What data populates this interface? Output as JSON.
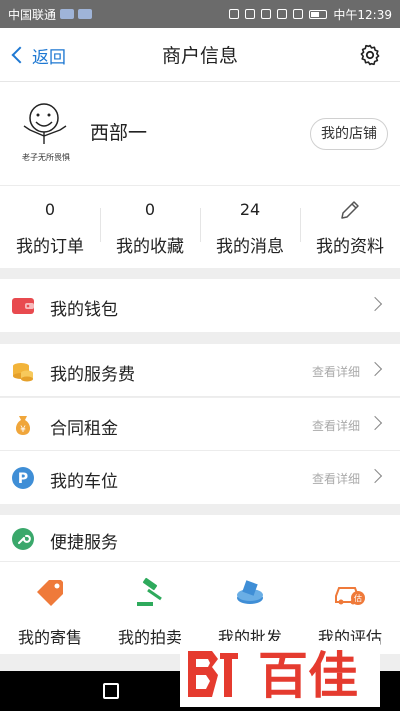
{
  "statusbar": {
    "carrier": "中国联通",
    "time": "中午12:39"
  },
  "navbar": {
    "back_label": "返回",
    "title": "商户信息"
  },
  "profile": {
    "name": "西部一",
    "avatar_caption": "老子无所畏惧",
    "shop_button": "我的店铺"
  },
  "stats": [
    {
      "value": "0",
      "label": "我的订单"
    },
    {
      "value": "0",
      "label": "我的收藏"
    },
    {
      "value": "24",
      "label": "我的消息"
    },
    {
      "value": "",
      "label": "我的资料"
    }
  ],
  "wallet": {
    "label": "我的钱包"
  },
  "list": [
    {
      "label": "我的服务费",
      "hint": "查看详细"
    },
    {
      "label": "合同租金",
      "hint": "查看详细"
    },
    {
      "label": "我的车位",
      "hint": "查看详细"
    }
  ],
  "services_header": {
    "label": "便捷服务"
  },
  "services": [
    {
      "label": "我的寄售"
    },
    {
      "label": "我的拍卖"
    },
    {
      "label": "我的批发"
    },
    {
      "label": "我的评估"
    }
  ],
  "watermark": {
    "text": "百佳"
  },
  "colors": {
    "accent": "#1e78d2",
    "wallet": "#e84a4f",
    "coins": "#f2b43a",
    "money": "#f0a63b",
    "parking": "#3f8ed6",
    "wrench": "#3aa86b",
    "service_orange": "#ef7a3a",
    "service_green": "#2eaa5c",
    "service_blue": "#3f8ed6",
    "watermark": "#e53b2f"
  }
}
